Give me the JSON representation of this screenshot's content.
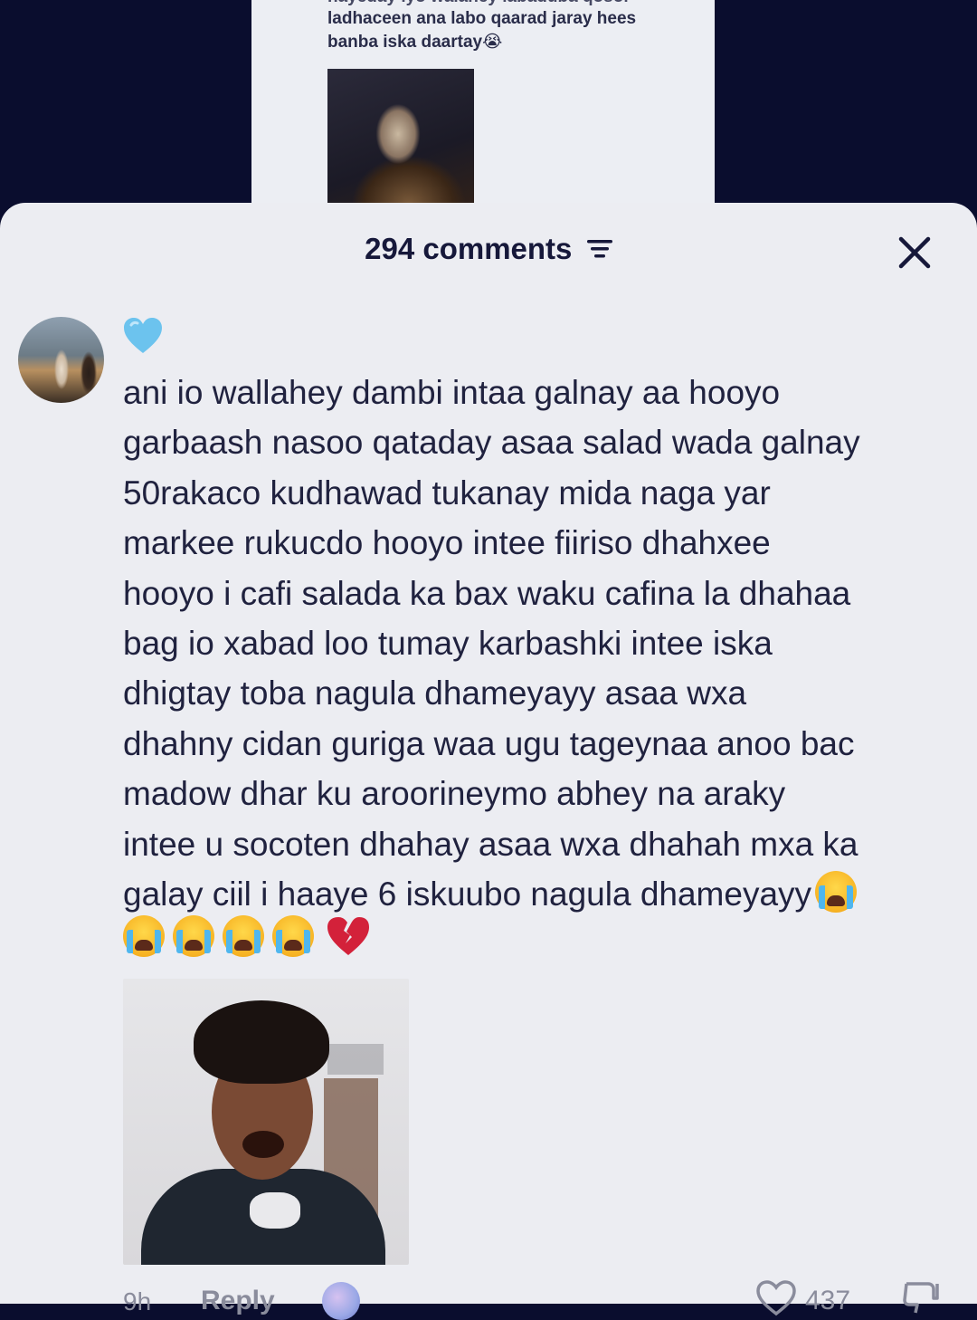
{
  "background_post": {
    "lines": [
      "nayeday iyo walahey labaduba qosol",
      "ladhaceen ana labo qaarad jaray hees",
      "banba iska daartay😭"
    ]
  },
  "comments_sheet": {
    "count_label": "294 comments",
    "comment": {
      "reaction_icon": "light-blue-heart-emoji",
      "lines": [
        "ani io wallahey dambi intaa galnay aa hooyo",
        "garbaash nasoo qataday asaa salad wada galnay",
        "50rakaco kudhawad tukanay mida naga yar",
        "markee rukucdo hooyo intee fiiriso dhahxee",
        "hooyo i cafi salada ka bax waku cafina la dhahaa",
        "bag io xabad loo tumay karbashki intee iska",
        "dhigtay toba nagula dhameyayy asaa wxa",
        "dhahny cidan guriga waa ugu tageynaa anoo bac",
        "madow dhar ku aroorineymo abhey na araky",
        "intee u socoten dhahay asaa wxa dhahah mxa ka",
        "galay ciil i haaye 6 iskuubo nagula dhameyayy"
      ],
      "trailing_emojis": [
        "loudly-crying-face",
        "loudly-crying-face",
        "loudly-crying-face",
        "loudly-crying-face",
        "loudly-crying-face",
        "broken-heart"
      ],
      "footer": {
        "time": "9h",
        "reply_label": "Reply",
        "like_count": "437"
      }
    }
  },
  "colors": {
    "background": "#0a0d2e",
    "sheet": "#ecedf2",
    "text": "#20223f",
    "muted": "#8a8c9c"
  }
}
